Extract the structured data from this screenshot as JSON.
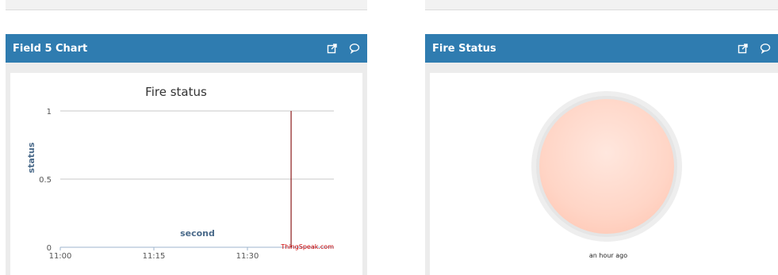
{
  "left_panel": {
    "title": "Field 5 Chart",
    "credit": "ThingSpeak.com"
  },
  "right_panel": {
    "title": "Fire Status",
    "timestamp": "an hour ago",
    "lamp_color": "#ffd5c6"
  },
  "header_icons": [
    "external-link-icon",
    "comment-icon"
  ],
  "colors": {
    "header": "#2f7cb0",
    "series": "#8b1a1a",
    "credit": "#cc0000"
  },
  "chart_data": {
    "type": "line",
    "title": "Fire status",
    "xlabel": "second",
    "ylabel": "status",
    "x_ticks": [
      "11:00",
      "11:15",
      "11:30"
    ],
    "y_ticks": [
      "0",
      "0.5",
      "1"
    ],
    "ylim": [
      0,
      1
    ],
    "grid": true,
    "series": [
      {
        "x": [
          "11:37",
          "11:37"
        ],
        "values": [
          0,
          1
        ]
      }
    ]
  }
}
